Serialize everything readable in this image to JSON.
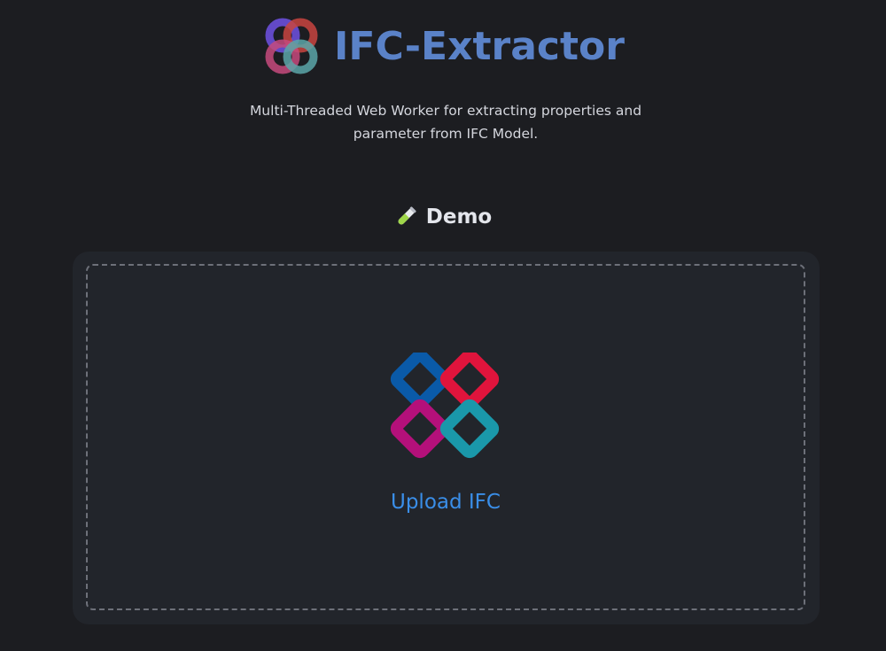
{
  "header": {
    "title": "IFC-Extractor",
    "logo_icon": "interlocking-rings-logo-icon",
    "title_color": "#5a82c8"
  },
  "subtitle": {
    "text": "Multi-Threaded Web Worker for extracting properties and parameter from IFC Model."
  },
  "demo": {
    "heading_icon": "test-tube-icon",
    "heading": "Demo",
    "upload": {
      "icon": "ifc-logo-icon",
      "label": "Upload IFC",
      "label_color": "#3a8ee8"
    }
  },
  "colors": {
    "background": "#1c1d21",
    "card": "#22252b",
    "ifc_blue": "#0a5aa8",
    "ifc_red": "#e0143c",
    "ifc_magenta": "#b4107a",
    "ifc_teal": "#1a98aa"
  }
}
